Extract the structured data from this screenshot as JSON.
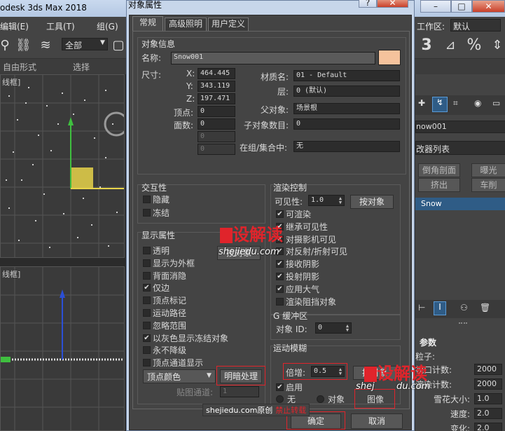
{
  "app": {
    "title_fragment": "odesk 3ds Max 2018",
    "menu": [
      "编辑(E)",
      "工具(T)",
      "组(G)"
    ],
    "selection_filter": "全部",
    "ribbon": [
      "自由形式",
      "选择"
    ],
    "workspace_label": "工作区:",
    "workspace_value": "默认",
    "viewport_top_label": "线框]",
    "viewport_front_label": "线框]"
  },
  "right_panel": {
    "object_name": "now001",
    "modifier_list": "改器列表",
    "buttons": [
      "倒角剖面",
      "曝光",
      "挤出",
      "车削"
    ],
    "stack_item": "Snow",
    "section": "参数",
    "particles_label": "粒子:",
    "rows": [
      {
        "label": "视口计数:",
        "value": "2000"
      },
      {
        "label": "渲染计数:",
        "value": "2000"
      },
      {
        "label": "雪花大小:",
        "value": "1.0"
      },
      {
        "label": "速度:",
        "value": "2.0"
      },
      {
        "label": "变化:",
        "value": "2.0"
      }
    ]
  },
  "dialog": {
    "title": "对象属性",
    "help_button": "?",
    "close_button": "✕",
    "tabs": [
      "常规",
      "高级照明",
      "用户定义"
    ],
    "object_info": {
      "group_title": "对象信息",
      "name_label": "名称:",
      "name_value": "Snow001",
      "color": "#f5c29c",
      "dims_label": "尺寸:",
      "x_label": "X:",
      "x_value": "464.445",
      "y_label": "Y:",
      "y_value": "343.119",
      "z_label": "Z:",
      "z_value": "197.471",
      "vertices_label": "顶点:",
      "vertices_value": "0",
      "faces_label": "面数:",
      "faces_value": "0",
      "extra1": "0",
      "extra2": "0",
      "material_label": "材质名:",
      "material_value": "01 - Default",
      "layer_label": "层:",
      "layer_value": "0 (默认)",
      "parent_label": "父对象:",
      "parent_value": "场景根",
      "children_label": "子对象数目:",
      "children_value": "0",
      "group_label": "在组/集合中:",
      "group_value": "无"
    },
    "interactivity": {
      "title": "交互性",
      "hide": "隐藏",
      "freeze": "冻结"
    },
    "display": {
      "title": "显示属性",
      "items": [
        {
          "label": "透明",
          "checked": false
        },
        {
          "label": "显示为外框",
          "checked": false
        },
        {
          "label": "背面消隐",
          "checked": false
        },
        {
          "label": "仅边",
          "checked": true
        },
        {
          "label": "顶点标记",
          "checked": false
        },
        {
          "label": "运动路径",
          "checked": false
        },
        {
          "label": "忽略范围",
          "checked": false
        },
        {
          "label": "以灰色显示冻结对象",
          "checked": true
        },
        {
          "label": "永不降级",
          "checked": false
        },
        {
          "label": "顶点通道显示",
          "checked": false
        }
      ],
      "by_object_button": "按对象",
      "vertex_color_select": "顶点颜色",
      "shading_button": "明暗处理",
      "map_channel_label": "贴图通道:",
      "map_channel_value": "1"
    },
    "render": {
      "title": "渲染控制",
      "visibility_label": "可见性:",
      "visibility_value": "1.0",
      "by_object_button": "按对象",
      "items": [
        {
          "label": "可渲染",
          "checked": true
        },
        {
          "label": "继承可见性",
          "checked": true
        },
        {
          "label": "对摄影机可见",
          "checked": true
        },
        {
          "label": "对反射/折射可见",
          "checked": true
        },
        {
          "label": "接收阴影",
          "checked": true
        },
        {
          "label": "投射阴影",
          "checked": true
        },
        {
          "label": "应用大气",
          "checked": true
        },
        {
          "label": "渲染阻挡对象",
          "checked": false
        }
      ]
    },
    "gbuffer": {
      "title": "G 缓冲区",
      "object_id_label": "对象 ID:",
      "object_id_value": "0"
    },
    "motion_blur": {
      "title": "运动模糊",
      "multiplier_label": "倍增:",
      "multiplier_value": "0.5",
      "by_object_button": "按对象",
      "enable_label": "启用",
      "enable_checked": true,
      "none_label": "无",
      "object_label": "对象",
      "image_label": "图像"
    },
    "ok_button": "确定",
    "cancel_button": "取消"
  },
  "watermarks": {
    "logo": "设解读",
    "url": "shejiedu.com",
    "url_partial": "shej",
    "url_tail": "du.com",
    "footer_prefix": "shejiedu.com原创",
    "footer_warning": "禁止转载"
  },
  "colors": {
    "accent_red": "#e0242b",
    "object_color": "#f5c29c",
    "gizmo_yellow": "#e8d44a"
  }
}
